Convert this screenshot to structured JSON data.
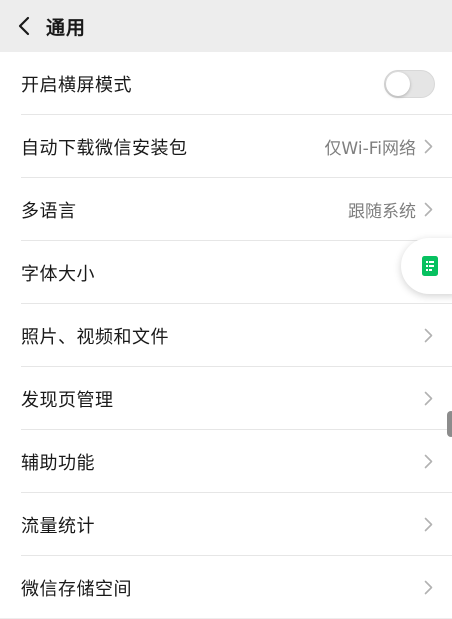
{
  "header": {
    "title": "通用",
    "back_icon": "chevron-left-icon"
  },
  "settings": [
    {
      "label": "开启横屏模式",
      "control": "toggle",
      "toggle_on": false
    },
    {
      "label": "自动下载微信安装包",
      "value": "仅Wi-Fi网络"
    },
    {
      "label": "多语言",
      "value": "跟随系统"
    },
    {
      "label": "字体大小"
    },
    {
      "label": "照片、视频和文件"
    },
    {
      "label": "发现页管理"
    },
    {
      "label": "辅助功能"
    },
    {
      "label": "流量统计"
    },
    {
      "label": "微信存储空间"
    }
  ],
  "floating_button": {
    "icon": "document-icon",
    "color": "#07c160"
  },
  "colors": {
    "background": "#ededed",
    "row": "#ffffff",
    "value_text": "#7f7f7f",
    "accent": "#07c160"
  }
}
